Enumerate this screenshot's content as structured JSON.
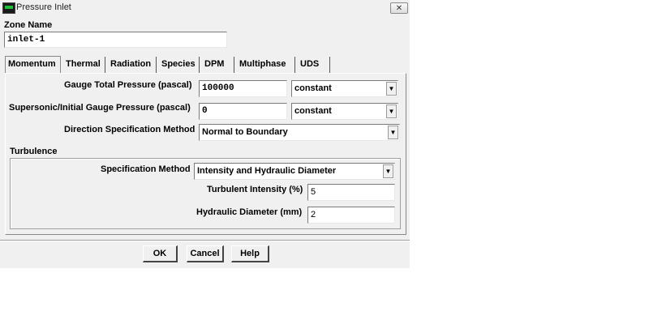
{
  "window": {
    "title": "Pressure Inlet",
    "close_glyph": "✕"
  },
  "zone": {
    "label": "Zone Name",
    "value": "inlet-1"
  },
  "tabs": [
    {
      "label": "Momentum"
    },
    {
      "label": "Thermal"
    },
    {
      "label": "Radiation"
    },
    {
      "label": "Species"
    },
    {
      "label": "DPM"
    },
    {
      "label": "Multiphase"
    },
    {
      "label": "UDS"
    }
  ],
  "momentum": {
    "gauge_total_pressure": {
      "label": "Gauge Total Pressure (pascal)",
      "value": "100000",
      "method": "constant"
    },
    "supersonic_pressure": {
      "label": "Supersonic/Initial Gauge Pressure (pascal)",
      "value": "0",
      "method": "constant"
    },
    "direction": {
      "label": "Direction Specification Method",
      "value": "Normal to Boundary"
    }
  },
  "turbulence": {
    "heading": "Turbulence",
    "spec_method": {
      "label": "Specification Method",
      "value": "Intensity and Hydraulic Diameter"
    },
    "intensity": {
      "label": "Turbulent Intensity (%)",
      "value": "5"
    },
    "hydraulic_diameter": {
      "label": "Hydraulic Diameter (mm)",
      "value": "2"
    }
  },
  "buttons": {
    "ok": "OK",
    "cancel": "Cancel",
    "help": "Help"
  },
  "icons": {
    "dropdown": "▼"
  }
}
